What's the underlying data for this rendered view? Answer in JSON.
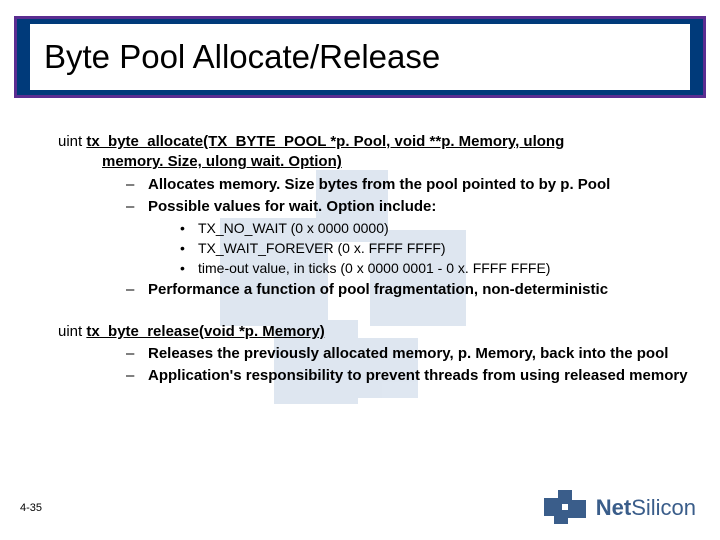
{
  "title": "Byte Pool Allocate/Release",
  "func1": {
    "ret": "uint ",
    "name": "tx_byte_allocate",
    "params_l1": "(TX_BYTE_POOL *p. Pool, void **p. Memory, ulong",
    "params_l2": "memory. Size, ulong wait. Option)",
    "bullets": [
      "Allocates memory. Size bytes from the pool pointed to by p. Pool",
      "Possible values for wait. Option include:"
    ],
    "sub": [
      "TX_NO_WAIT (0 x 0000 0000)",
      "TX_WAIT_FOREVER (0 x. FFFF FFFF)",
      "time-out value, in ticks (0 x 0000 0001 - 0 x. FFFF FFFE)"
    ],
    "tail": "Performance a function of pool fragmentation, non-deterministic"
  },
  "func2": {
    "ret": "uint ",
    "name": "tx_byte_release",
    "params": "(void *p. Memory)",
    "bullets": [
      "Releases the previously allocated memory, p. Memory, back into the pool",
      "Application's responsibility to prevent threads from using released memory"
    ]
  },
  "page_number": "4-35",
  "brand": {
    "a": "Net",
    "b": "Silicon"
  }
}
